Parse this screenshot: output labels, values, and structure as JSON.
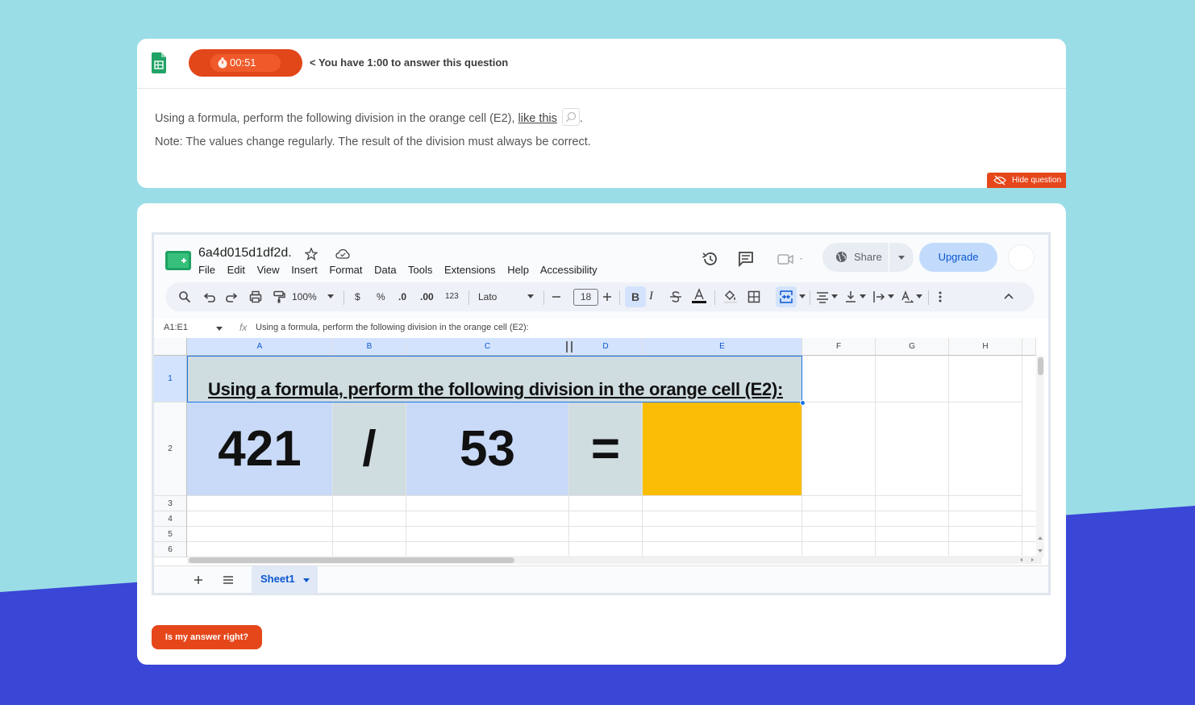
{
  "colors": {
    "accent_orange": "#e5471b",
    "cell_orange": "#fbbc04",
    "cell_blue": "#c9daf8",
    "cell_gray": "#cfdce0",
    "bg_blue": "#3a46d6",
    "bg_cyan": "#9adde6"
  },
  "timer": {
    "value": "00:51"
  },
  "question": {
    "hint": "< You have 1:00 to answer this question",
    "line1_prefix": "Using a formula, perform the following division in the orange cell (E2), ",
    "line1_link": "like this",
    "line1_suffix": ".",
    "line2": "Note: The values change regularly. The result of the division must always be correct.",
    "hide_label": "Hide question"
  },
  "sheets": {
    "doc_title": "6a4d015d1df2d.",
    "menu": [
      "File",
      "Edit",
      "View",
      "Insert",
      "Format",
      "Data",
      "Tools",
      "Extensions",
      "Help",
      "Accessibility"
    ],
    "share_label": "Share",
    "upgrade_label": "Upgrade",
    "toolbar": {
      "zoom": "100%",
      "currency": "$",
      "percent": "%",
      "dec_less": ".0",
      "dec_more": ".00",
      "format_123": "123",
      "font": "Lato",
      "font_size": "18",
      "bold": "B",
      "italic": "I"
    },
    "name_box": "A1:E1",
    "formula": "Using a formula, perform the following division in the orange cell (E2):",
    "columns": [
      "A",
      "B",
      "C",
      "D",
      "E",
      "F",
      "G",
      "H"
    ],
    "rows": [
      "1",
      "2",
      "3",
      "4",
      "5",
      "6"
    ],
    "row1_text": "Using a formula, perform the following division in the orange cell (E2):",
    "row2": {
      "a": "421",
      "b": "/",
      "c": "53",
      "d": "=",
      "e": ""
    },
    "sheet_tab": "Sheet1"
  },
  "answer_button": "Is my answer right?"
}
